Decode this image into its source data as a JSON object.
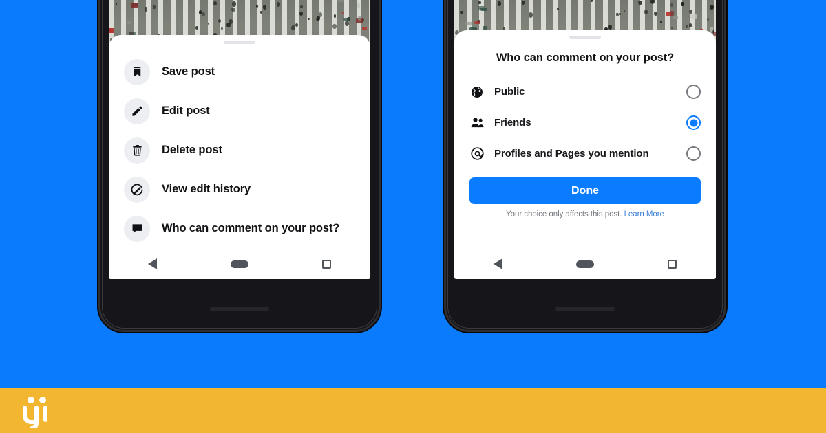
{
  "background": {
    "color": "#0B7BFD",
    "brand_bar_color": "#F2B630",
    "logo_name": "brand-logo"
  },
  "accent": {
    "facebook_blue": "#0A7CFF",
    "link_blue": "#3B7FD4",
    "icon_bg": "#EDEEF1"
  },
  "left_phone": {
    "photo_alt": "aerial-crosswalk-photo",
    "menu": {
      "items": [
        {
          "label": "Save post",
          "icon": "bookmark-icon"
        },
        {
          "label": "Edit post",
          "icon": "pencil-icon"
        },
        {
          "label": "Delete post",
          "icon": "trash-icon"
        },
        {
          "label": "View edit history",
          "icon": "edit-history-icon"
        },
        {
          "label": "Who can comment on your post?",
          "icon": "comment-bubble-icon"
        }
      ]
    },
    "navbar": {
      "back": "back-triangle",
      "home": "home-pill",
      "recents": "recents-square"
    }
  },
  "right_phone": {
    "photo_alt": "aerial-crosswalk-photo",
    "dialog": {
      "title": "Who can comment on your post?",
      "options": [
        {
          "label": "Public",
          "icon": "globe-icon",
          "selected": false
        },
        {
          "label": "Friends",
          "icon": "friends-icon",
          "selected": true
        },
        {
          "label": "Profiles and Pages you mention",
          "icon": "at-icon",
          "selected": false
        }
      ],
      "done_label": "Done",
      "footnote_text": "Your choice only affects this post.",
      "footnote_link": "Learn More"
    },
    "navbar": {
      "back": "back-triangle",
      "home": "home-pill",
      "recents": "recents-square"
    }
  }
}
